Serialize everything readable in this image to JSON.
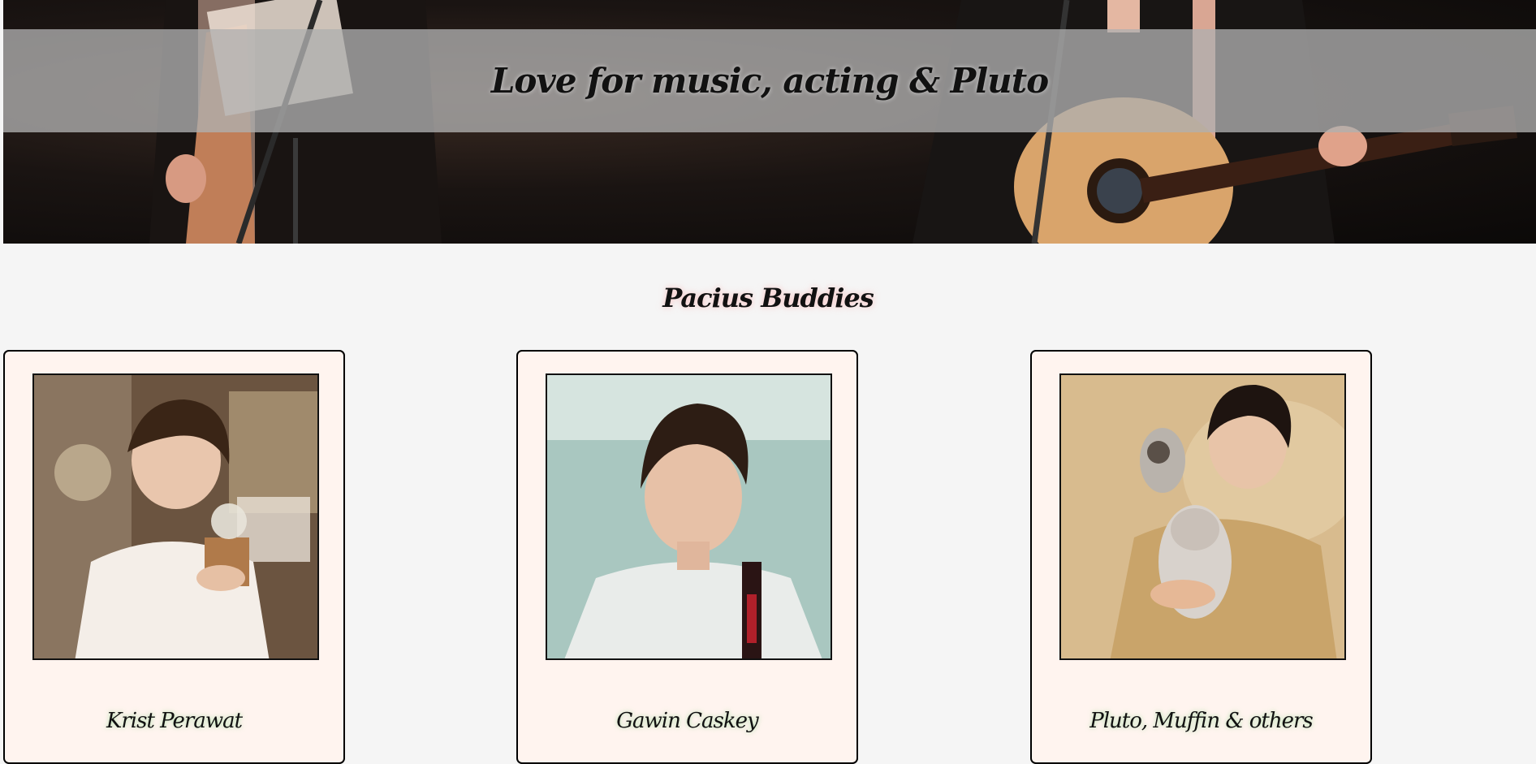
{
  "hero": {
    "title": "Love for music, acting & Pluto"
  },
  "buddies": {
    "title": "Pacius Buddies",
    "cards": [
      {
        "name": "Krist Perawat"
      },
      {
        "name": "Gawin Caskey"
      },
      {
        "name": "Pluto, Muffin & others"
      }
    ]
  }
}
